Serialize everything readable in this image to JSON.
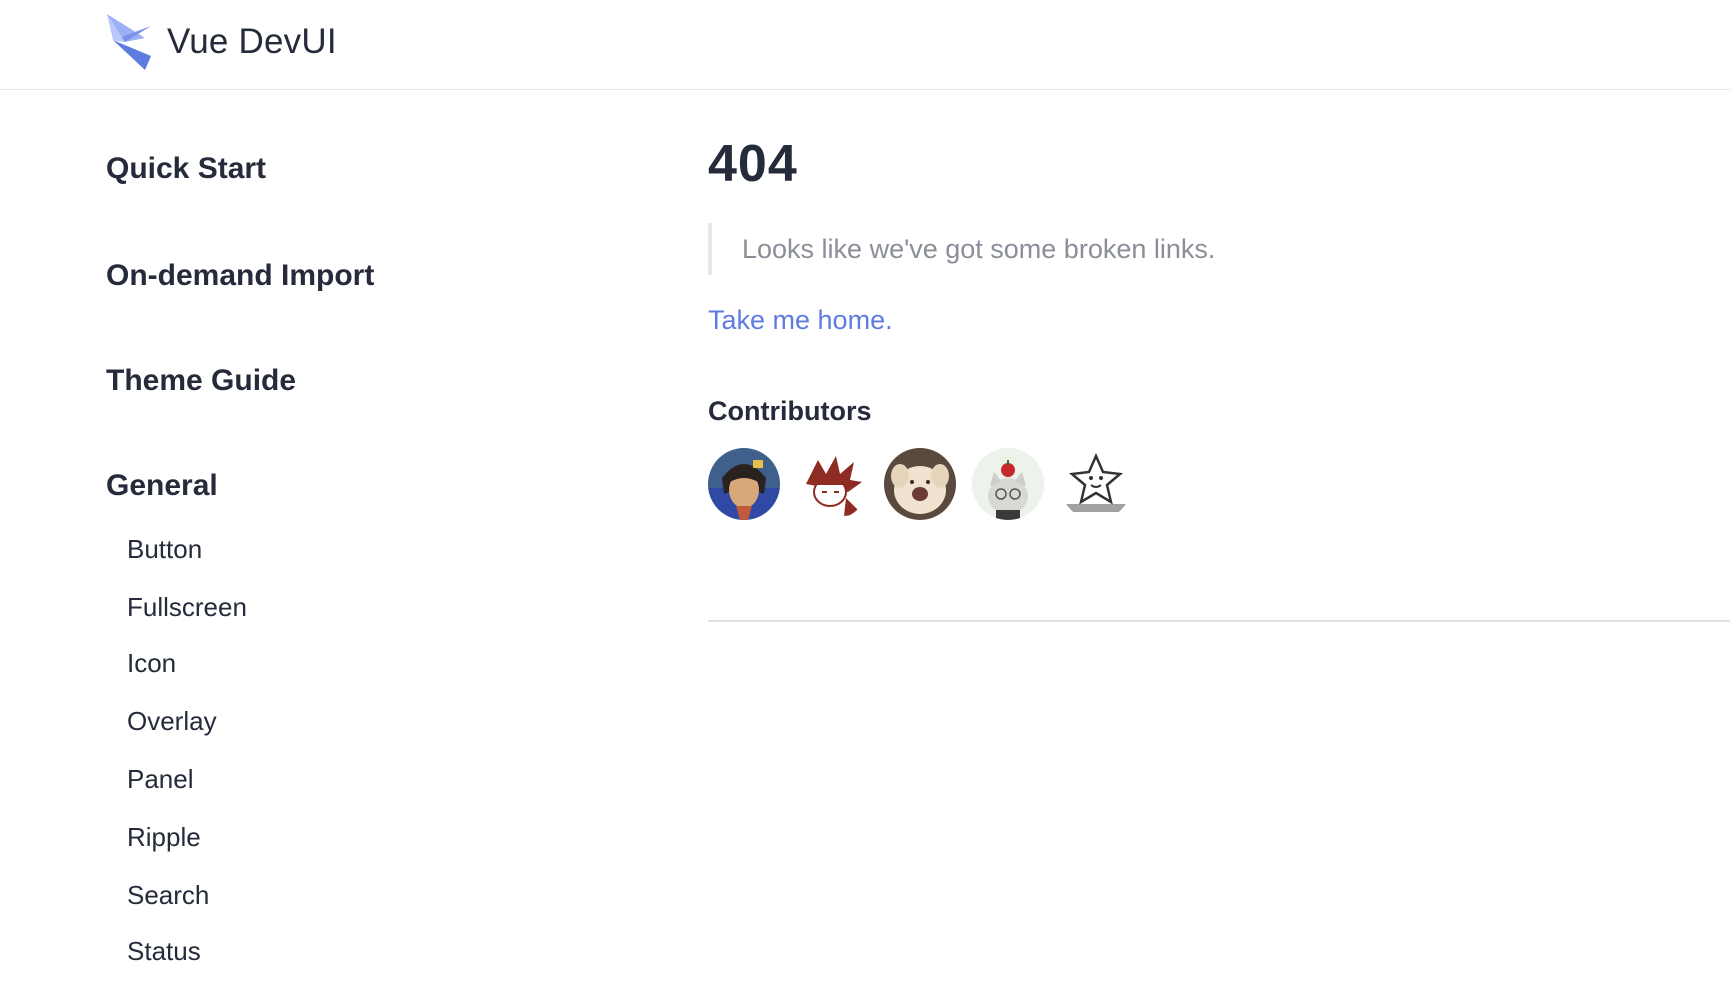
{
  "header": {
    "brand_title": "Vue DevUI",
    "logo_icon": "devui-logo-icon",
    "colors": {
      "logo_light": "#8ea6f5",
      "logo_dark": "#5e7ce0"
    }
  },
  "sidebar": {
    "groups": [
      {
        "label": "Quick Start"
      },
      {
        "label": "On-demand Import"
      },
      {
        "label": "Theme Guide"
      },
      {
        "label": "General",
        "items": [
          {
            "label": "Button"
          },
          {
            "label": "Fullscreen"
          },
          {
            "label": "Icon"
          },
          {
            "label": "Overlay"
          },
          {
            "label": "Panel"
          },
          {
            "label": "Ripple"
          },
          {
            "label": "Search"
          },
          {
            "label": "Status"
          }
        ]
      }
    ]
  },
  "main": {
    "title": "404",
    "quote": "Looks like we've got some broken links.",
    "home_link": "Take me home.",
    "contributors_title": "Contributors",
    "contributors": [
      {
        "icon": "anime-portrait-avatar-icon"
      },
      {
        "icon": "naruto-sketch-avatar-icon"
      },
      {
        "icon": "puppy-avatar-icon"
      },
      {
        "icon": "cat-with-apple-avatar-icon"
      },
      {
        "icon": "star-sticker-avatar-icon"
      }
    ]
  },
  "colors": {
    "text": "#252b3a",
    "muted": "#8a8e99",
    "link": "#5e7ce0",
    "border": "#dfe1e6"
  }
}
